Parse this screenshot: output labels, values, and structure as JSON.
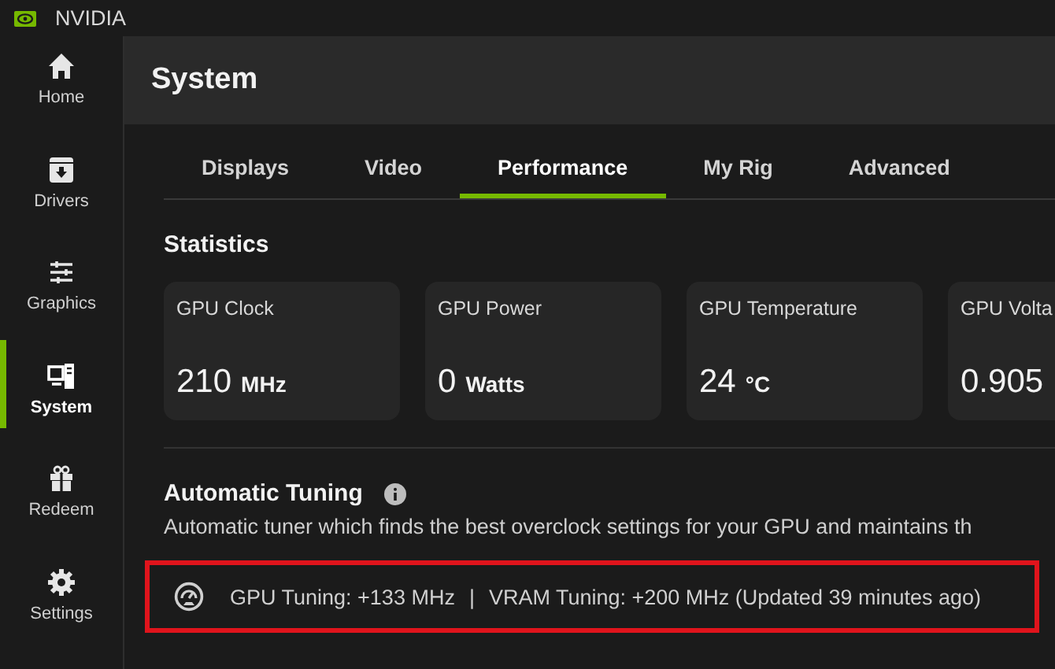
{
  "window": {
    "title": "NVIDIA"
  },
  "sidebar": {
    "items": [
      {
        "kind": "home",
        "label": "Home",
        "selected": false
      },
      {
        "kind": "drivers",
        "label": "Drivers",
        "selected": false
      },
      {
        "kind": "graphics",
        "label": "Graphics",
        "selected": false
      },
      {
        "kind": "system",
        "label": "System",
        "selected": true
      },
      {
        "kind": "redeem",
        "label": "Redeem",
        "selected": false
      },
      {
        "kind": "settings",
        "label": "Settings",
        "selected": false
      }
    ]
  },
  "page": {
    "title": "System"
  },
  "tabs": [
    {
      "label": "Displays",
      "selected": false
    },
    {
      "label": "Video",
      "selected": false
    },
    {
      "label": "Performance",
      "selected": true
    },
    {
      "label": "My Rig",
      "selected": false
    },
    {
      "label": "Advanced",
      "selected": false
    }
  ],
  "statistics": {
    "heading": "Statistics",
    "cards": [
      {
        "label": "GPU Clock",
        "value": "210",
        "unit": "MHz"
      },
      {
        "label": "GPU Power",
        "value": "0",
        "unit": "Watts"
      },
      {
        "label": "GPU Temperature",
        "value": "24",
        "unit": "°C"
      },
      {
        "label": "GPU Volta",
        "value": "0.905"
      }
    ]
  },
  "automatic_tuning": {
    "heading": "Automatic Tuning",
    "description": "Automatic tuner which finds the best overclock settings for your GPU and maintains th",
    "status": {
      "highlighted": true,
      "gpu_tuning": "GPU Tuning: +133 MHz",
      "separator": "|",
      "vram_tuning": "VRAM Tuning: +200 MHz (Updated 39 minutes ago)"
    }
  }
}
